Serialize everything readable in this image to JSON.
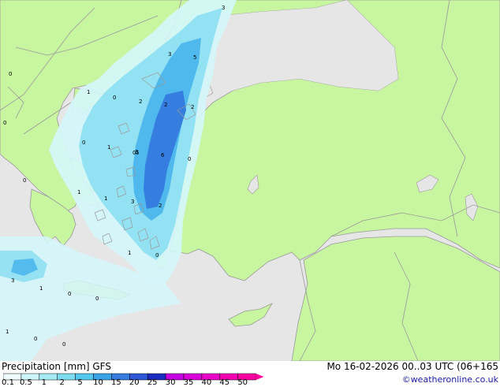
{
  "header": {
    "title": "Precipitation [mm]  GFS",
    "datetime": "Mo 16-02-2026 00..03 UTC (06+165",
    "credit": "©weatheronline.co.uk"
  },
  "legend": {
    "ticks": [
      "0.1",
      "0.5",
      "1",
      "2",
      "5",
      "10",
      "15",
      "20",
      "25",
      "30",
      "35",
      "40",
      "45",
      "50"
    ],
    "colors": [
      "#eefcfd",
      "#cdf4f8",
      "#a6ebf4",
      "#7ddcf0",
      "#53c8ec",
      "#3aa2e6",
      "#357ee0",
      "#2f58d6",
      "#1c2cc0",
      "#c400e0",
      "#d800d8",
      "#e800c8",
      "#f000b0",
      "#f800a0"
    ]
  },
  "map": {
    "colors": {
      "land": "#c8f5a0",
      "sea": "#e6e6e6",
      "border": "#9a9a9a",
      "precip_light": "#d4f6fa",
      "precip_mid": "#8fe0f2",
      "precip_heavy": "#4fb8ec",
      "precip_max": "#2a50d8"
    },
    "labels": [
      "3",
      "3",
      "5",
      "2",
      "2",
      "2",
      "1",
      "0",
      "0",
      "0",
      "0",
      "1",
      "0",
      "3",
      "5",
      "6",
      "3",
      "2",
      "1",
      "1",
      "1",
      "0",
      "3",
      "1",
      "0",
      "0",
      "0",
      "1",
      "0",
      "0",
      "0"
    ]
  }
}
